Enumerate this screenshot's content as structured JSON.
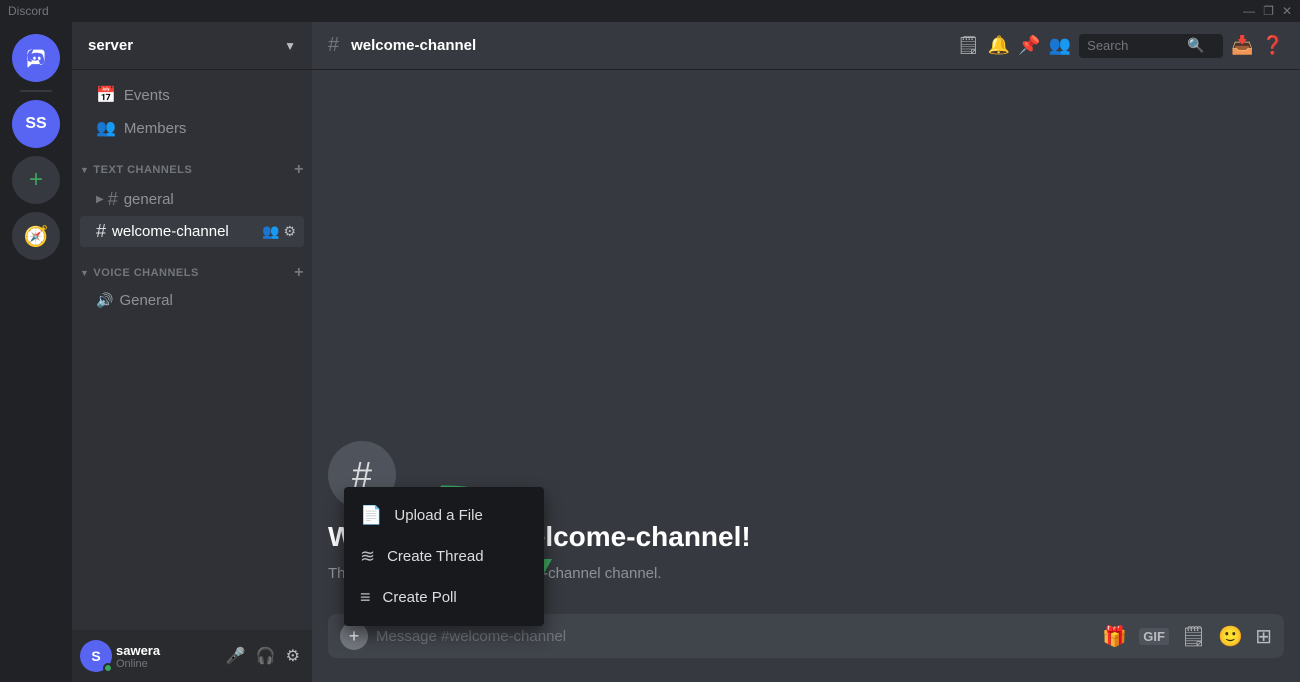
{
  "titleBar": {
    "appName": "Discord",
    "controls": {
      "minimize": "—",
      "maximize": "❐",
      "close": "✕"
    }
  },
  "serverSidebar": {
    "discordIcon": "🎮",
    "userInitials": "SS",
    "addLabel": "+",
    "exploreLabel": "🧭"
  },
  "channelSidebar": {
    "serverName": "server",
    "navItems": [
      {
        "id": "events",
        "icon": "📅",
        "label": "Events"
      },
      {
        "id": "members",
        "icon": "👥",
        "label": "Members"
      }
    ],
    "textChannelsCategory": "TEXT CHANNELS",
    "textChannels": [
      {
        "id": "general",
        "label": "general"
      },
      {
        "id": "welcome-channel",
        "label": "welcome-channel",
        "active": true
      }
    ],
    "voiceChannelsCategory": "VOICE CHANNELS",
    "voiceChannels": [
      {
        "id": "general-voice",
        "icon": "🔊",
        "label": "General"
      }
    ],
    "user": {
      "name": "sawera",
      "status": "Online",
      "initials": "S"
    }
  },
  "channelHeader": {
    "channelName": "welcome-channel",
    "searchPlaceholder": "Search"
  },
  "welcomeSection": {
    "icon": "#",
    "title": "Welcome to #welcome-channel!",
    "description": "This is the start of the #welcome-channel channel."
  },
  "messageInput": {
    "placeholder": "Message #welcome-channel"
  },
  "popupMenu": {
    "items": [
      {
        "id": "upload-file",
        "icon": "📄",
        "label": "Upload a File"
      },
      {
        "id": "create-thread",
        "icon": "≋",
        "label": "Create Thread"
      },
      {
        "id": "create-poll",
        "icon": "≡",
        "label": "Create Poll"
      }
    ]
  },
  "inputIcons": {
    "gift": "🎁",
    "gif": "GIF",
    "sticker": "🗒",
    "emoji": "🙂",
    "people": "⊞"
  }
}
